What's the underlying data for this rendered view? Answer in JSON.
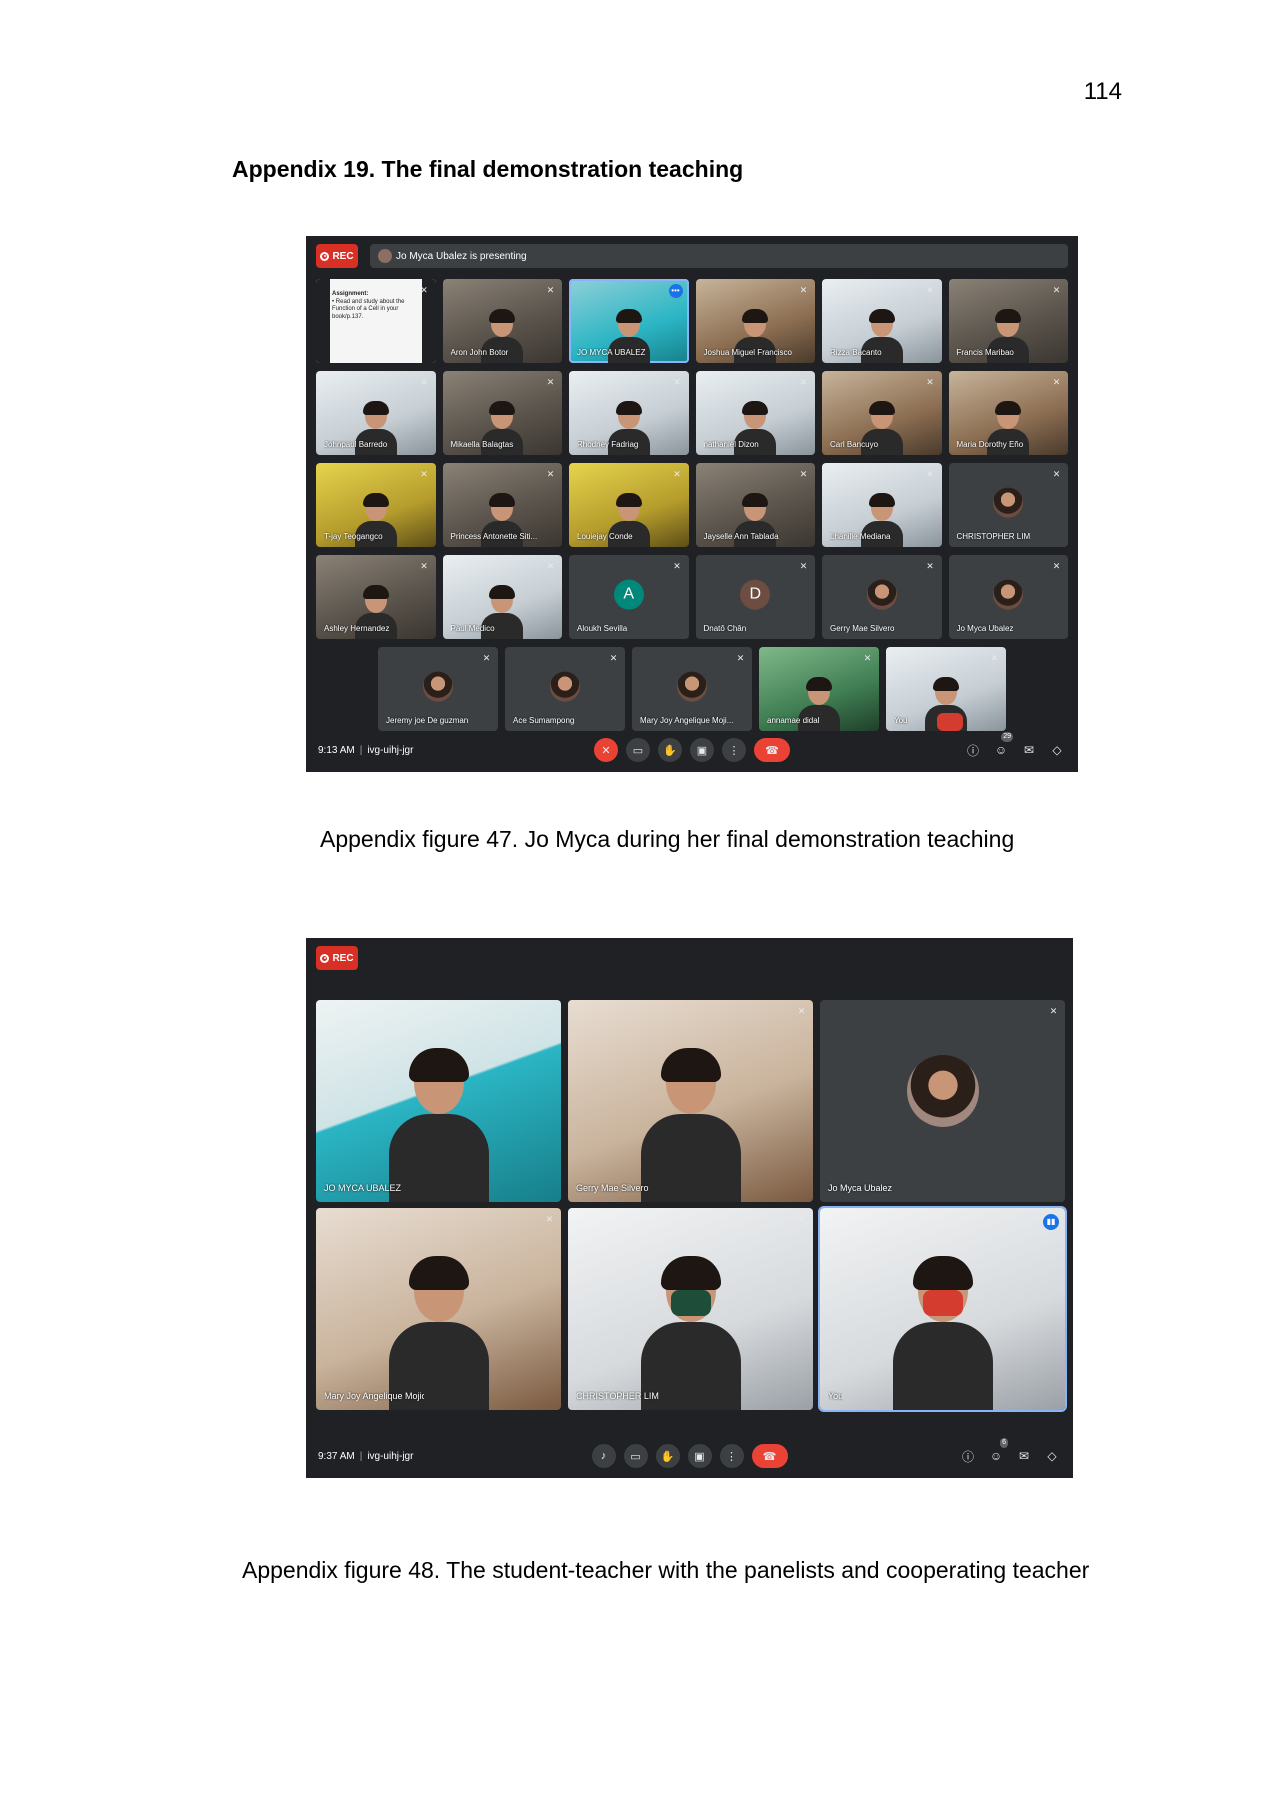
{
  "page_number": "114",
  "heading": "Appendix 19. The final demonstration teaching",
  "figure1": {
    "caption": "Appendix figure 47. Jo Myca during her final demonstration teaching",
    "rec_label": "REC",
    "presenting_text": "Jo Myca Ubalez is presenting",
    "doc_title": "Assignment:",
    "doc_text": "• Read and study about the Function of a Cell in your book/p.137.",
    "rows": [
      [
        {
          "name": "",
          "style": "doc"
        },
        {
          "name": "Aron John Botor",
          "style": "video"
        },
        {
          "name": "JO MYCA UBALEZ",
          "style": "teal",
          "selected": true
        },
        {
          "name": "Joshua Miguel Francisco",
          "style": "warm"
        },
        {
          "name": "Rizza Bacanto",
          "style": "bright"
        },
        {
          "name": "Francis Maribao",
          "style": "video"
        }
      ],
      [
        {
          "name": "Johnpaul Barredo",
          "style": "bright"
        },
        {
          "name": "Mikaella Balagtas",
          "style": "video"
        },
        {
          "name": "Rhodney Fadriag",
          "style": "bright"
        },
        {
          "name": "nathaniel Dizon",
          "style": "bright"
        },
        {
          "name": "Carl Bancuyo",
          "style": "warm"
        },
        {
          "name": "Maria Dorothy Eño",
          "style": "warm"
        }
      ],
      [
        {
          "name": "T-jay Teogangco",
          "style": "yellow"
        },
        {
          "name": "Princess Antonette Siti...",
          "style": "video"
        },
        {
          "name": "Louiejay Conde",
          "style": "yellow"
        },
        {
          "name": "Jayselle Ann Tablada",
          "style": "video"
        },
        {
          "name": "Lhanille Mediana",
          "style": "bright"
        },
        {
          "name": "CHRISTOPHER LIM",
          "style": "avatar-photo"
        }
      ],
      [
        {
          "name": "Ashley Hernandez",
          "style": "video"
        },
        {
          "name": "Paul Medico",
          "style": "bright"
        },
        {
          "name": "Aloukh Sevilla",
          "style": "avatar",
          "letter": "A",
          "color": "#00897b"
        },
        {
          "name": "Dnatô Chân",
          "style": "avatar",
          "letter": "D",
          "color": "#6d4c41"
        },
        {
          "name": "Gerry Mae Silvero",
          "style": "avatar-photo"
        },
        {
          "name": "Jo Myca Ubalez",
          "style": "avatar-photo"
        }
      ],
      [
        {
          "name": "Jeremy joe De guzman",
          "style": "avatar-photo"
        },
        {
          "name": "Ace Sumampong",
          "style": "avatar-photo"
        },
        {
          "name": "Mary Joy Angelique Moji...",
          "style": "avatar-photo"
        },
        {
          "name": "annamae didal",
          "style": "green"
        },
        {
          "name": "You",
          "style": "bright-mask"
        }
      ]
    ],
    "time": "9:13 AM",
    "meeting_code": "ivg-uihj-jgr",
    "participants_count": "29"
  },
  "figure2": {
    "caption": "Appendix figure 48. The student-teacher with the panelists and cooperating teacher",
    "rec_label": "REC",
    "tiles": [
      {
        "name": "JO MYCA UBALEZ",
        "style": "teal"
      },
      {
        "name": "Gerry Mae Silvero",
        "style": "warm"
      },
      {
        "name": "Jo Myca Ubalez",
        "style": "avatar-photo"
      },
      {
        "name": "Mary Joy Angelique Mojica",
        "style": "warm"
      },
      {
        "name": "CHRISTOPHER LIM",
        "style": "bright-mask-green"
      },
      {
        "name": "You",
        "style": "bright-mask"
      }
    ],
    "time": "9:37 AM",
    "meeting_code": "ivg-uihj-jgr",
    "participants_count": "6"
  },
  "icons": {
    "mic_off": "🎙",
    "camera": "▭",
    "hand": "✋",
    "present": "▣",
    "more": "⋮",
    "end_call": "☎",
    "info": "ⓘ",
    "people": "👥",
    "chat": "✉",
    "activities": "◇"
  },
  "colors": {
    "meet_bg": "#202124",
    "tile_bg": "#3c4043",
    "rec_red": "#d93025",
    "end_red": "#ea4335",
    "accent_blue": "#1a73e8"
  }
}
